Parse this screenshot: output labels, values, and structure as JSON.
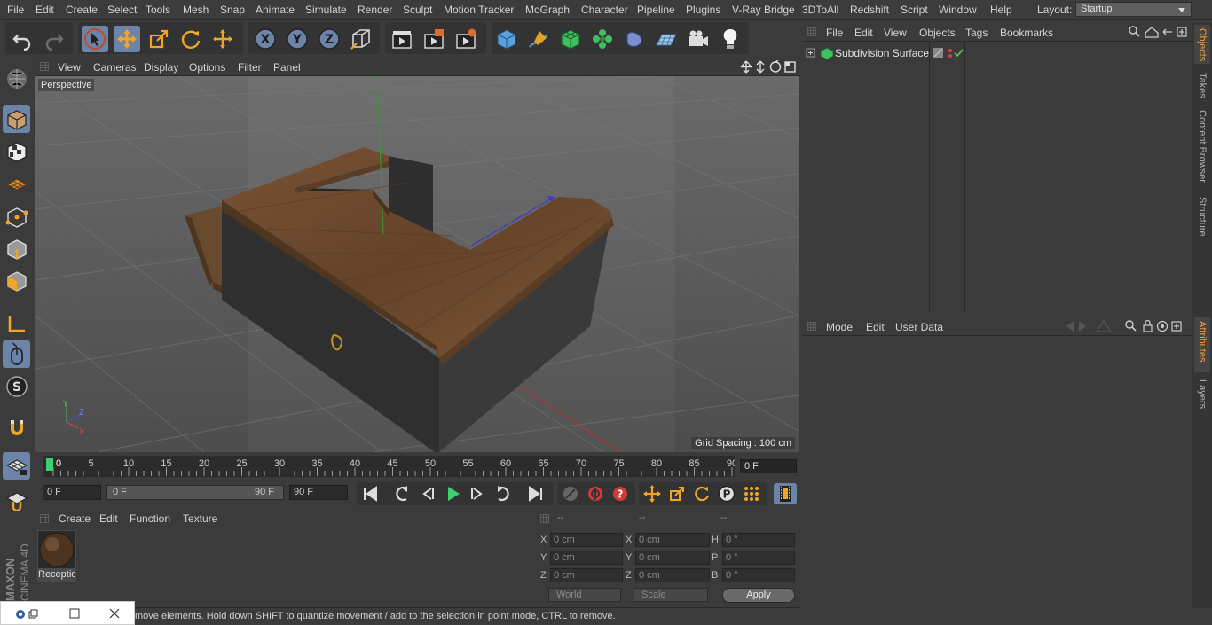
{
  "menubar": {
    "items": [
      "File",
      "Edit",
      "Create",
      "Select",
      "Tools",
      "Mesh",
      "Snap",
      "Animate",
      "Simulate",
      "Render",
      "Sculpt",
      "Motion Tracker",
      "MoGraph",
      "Character",
      "Pipeline",
      "Plugins",
      "V-Ray Bridge",
      "3DToAll",
      "Redshift",
      "Script",
      "Window",
      "Help"
    ],
    "layout_label": "Layout:",
    "layout_value": "Startup"
  },
  "toolbar": {
    "icons": [
      "undo-icon",
      "redo-icon",
      "live-select-icon",
      "move-icon",
      "scale-icon",
      "rotate-icon",
      "last-tool-icon",
      "x-axis-icon",
      "y-axis-icon",
      "z-axis-icon",
      "world-coord-icon",
      "render-view-icon",
      "render-picture-icon",
      "render-settings-icon",
      "cube-icon",
      "pen-icon",
      "subdivision-icon",
      "cloner-icon",
      "deformer-icon",
      "floor-icon",
      "camera-icon",
      "light-icon"
    ],
    "axis_labels": [
      "X",
      "Y",
      "Z"
    ]
  },
  "viewport": {
    "menu": [
      "View",
      "Cameras",
      "Display",
      "Options",
      "Filter",
      "Panel"
    ],
    "label": "Perspective",
    "grid_spacing": "Grid Spacing : 100 cm",
    "axis_labels": [
      "Y",
      "Z",
      "X"
    ]
  },
  "timeline": {
    "ticks": [
      "0",
      "5",
      "10",
      "15",
      "20",
      "25",
      "30",
      "35",
      "40",
      "45",
      "50",
      "55",
      "60",
      "65",
      "70",
      "75",
      "80",
      "85",
      "90"
    ],
    "current_frame": "0 F",
    "current_marker": 0
  },
  "transport": {
    "start_field": "0 F",
    "range_start": "0 F",
    "range_end": "90 F",
    "end_field": "90 F"
  },
  "material_panel": {
    "menu": [
      "Create",
      "Edit",
      "Function",
      "Texture"
    ],
    "material_name": "Receptio"
  },
  "coord_panel": {
    "headers": [
      "--",
      "--",
      "--"
    ],
    "row1": {
      "l1": "X",
      "v1": "0 cm",
      "l2": "X",
      "v2": "0 cm",
      "l3": "H",
      "v3": "0 °"
    },
    "row2": {
      "l1": "Y",
      "v1": "0 cm",
      "l2": "Y",
      "v2": "0 cm",
      "l3": "P",
      "v3": "0 °"
    },
    "row3": {
      "l1": "Z",
      "v1": "0 cm",
      "l2": "Z",
      "v2": "0 cm",
      "l3": "B",
      "v3": "0 °"
    },
    "world": "World",
    "scale": "Scale",
    "apply": "Apply"
  },
  "status_text": "move elements. Hold down SHIFT to quantize movement / add to the selection in point mode, CTRL to remove.",
  "object_panel": {
    "menu": [
      "File",
      "Edit",
      "View",
      "Objects",
      "Tags",
      "Bookmarks"
    ],
    "object_name": "Subdivision Surface"
  },
  "attr_panel": {
    "menu": [
      "Mode",
      "Edit",
      "User Data"
    ]
  },
  "side_tabs_top": [
    "Objects",
    "Takes",
    "Content Browser",
    "Structure"
  ],
  "side_tabs_bottom": [
    "Attributes",
    "Layers"
  ],
  "branding": {
    "line1": "MAXON",
    "line2": "CINEMA 4D"
  },
  "colors": {
    "accent": "#6b84a8",
    "wood": "#6b4a2e",
    "box": "#353535",
    "orange": "#f0a040"
  }
}
